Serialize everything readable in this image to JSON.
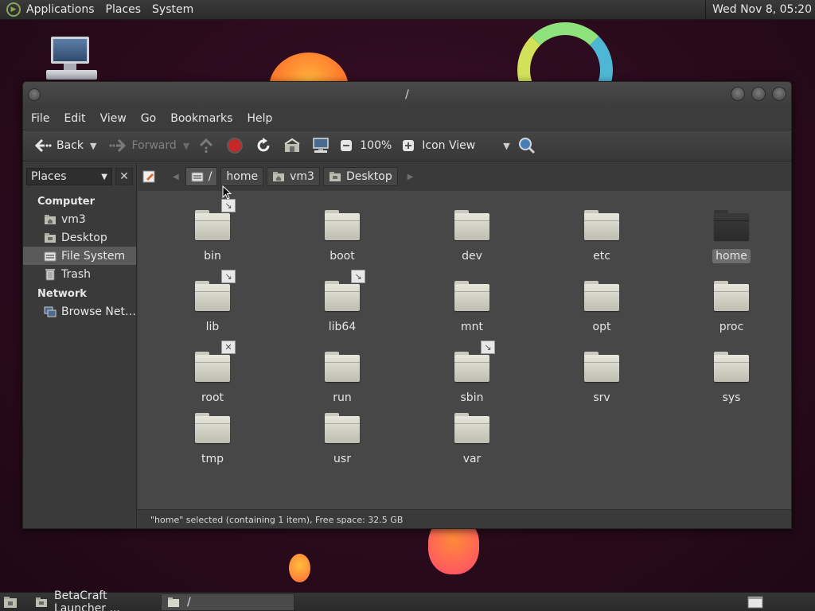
{
  "top_panel": {
    "menus": [
      "Applications",
      "Places",
      "System"
    ],
    "clock": "Wed Nov 8, 05:20"
  },
  "window": {
    "title": "/",
    "menubar": [
      "File",
      "Edit",
      "View",
      "Go",
      "Bookmarks",
      "Help"
    ],
    "toolbar": {
      "back_label": "Back",
      "forward_label": "Forward",
      "zoom": "100%",
      "view_mode": "Icon View"
    },
    "sidebar": {
      "combo_label": "Places",
      "sections": [
        {
          "title": "Computer",
          "items": [
            "vm3",
            "Desktop",
            "File System",
            "Trash"
          ]
        },
        {
          "title": "Network",
          "items": [
            "Browse Net…"
          ]
        }
      ]
    },
    "pathbar": {
      "crumbs": [
        "/",
        "home",
        "vm3",
        "Desktop"
      ]
    },
    "files": [
      {
        "name": "bin",
        "emblem": "link"
      },
      {
        "name": "boot",
        "emblem": ""
      },
      {
        "name": "dev",
        "emblem": ""
      },
      {
        "name": "etc",
        "emblem": ""
      },
      {
        "name": "home",
        "emblem": "",
        "selected": true
      },
      {
        "name": "lib",
        "emblem": "link"
      },
      {
        "name": "lib64",
        "emblem": "link"
      },
      {
        "name": "mnt",
        "emblem": ""
      },
      {
        "name": "opt",
        "emblem": ""
      },
      {
        "name": "proc",
        "emblem": ""
      },
      {
        "name": "root",
        "emblem": "unreadable"
      },
      {
        "name": "run",
        "emblem": ""
      },
      {
        "name": "sbin",
        "emblem": "link"
      },
      {
        "name": "srv",
        "emblem": ""
      },
      {
        "name": "sys",
        "emblem": ""
      },
      {
        "name": "tmp",
        "emblem": ""
      },
      {
        "name": "usr",
        "emblem": ""
      },
      {
        "name": "var",
        "emblem": ""
      }
    ],
    "status": "\"home\" selected (containing 1 item), Free space: 32.5 GB"
  },
  "taskbar": {
    "tasks": [
      "BetaCraft Launcher ...",
      "/"
    ]
  }
}
